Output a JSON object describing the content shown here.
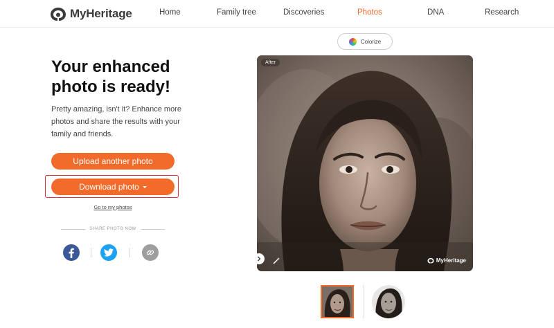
{
  "brand": {
    "name": "MyHeritage",
    "accent_color": "#f26b2b"
  },
  "nav": {
    "items": [
      {
        "label": "Home",
        "active": false
      },
      {
        "label": "Family tree",
        "active": false
      },
      {
        "label": "Discoveries",
        "active": false
      },
      {
        "label": "Photos",
        "active": true
      },
      {
        "label": "DNA",
        "active": false
      },
      {
        "label": "Research",
        "active": false
      }
    ]
  },
  "main": {
    "headline": "Your enhanced photo is ready!",
    "body": "Pretty amazing, isn't it? Enhance more photos and share the results with your family and friends.",
    "upload_label": "Upload another photo",
    "download_label": "Download photo",
    "go_label": "Go to my photos"
  },
  "share": {
    "label": "SHARE PHOTO NOW",
    "icons": [
      "facebook-icon",
      "twitter-icon",
      "link-icon"
    ]
  },
  "photo": {
    "colorize_label": "Colorize",
    "after_badge": "After",
    "watermark": "MyHeritage"
  }
}
